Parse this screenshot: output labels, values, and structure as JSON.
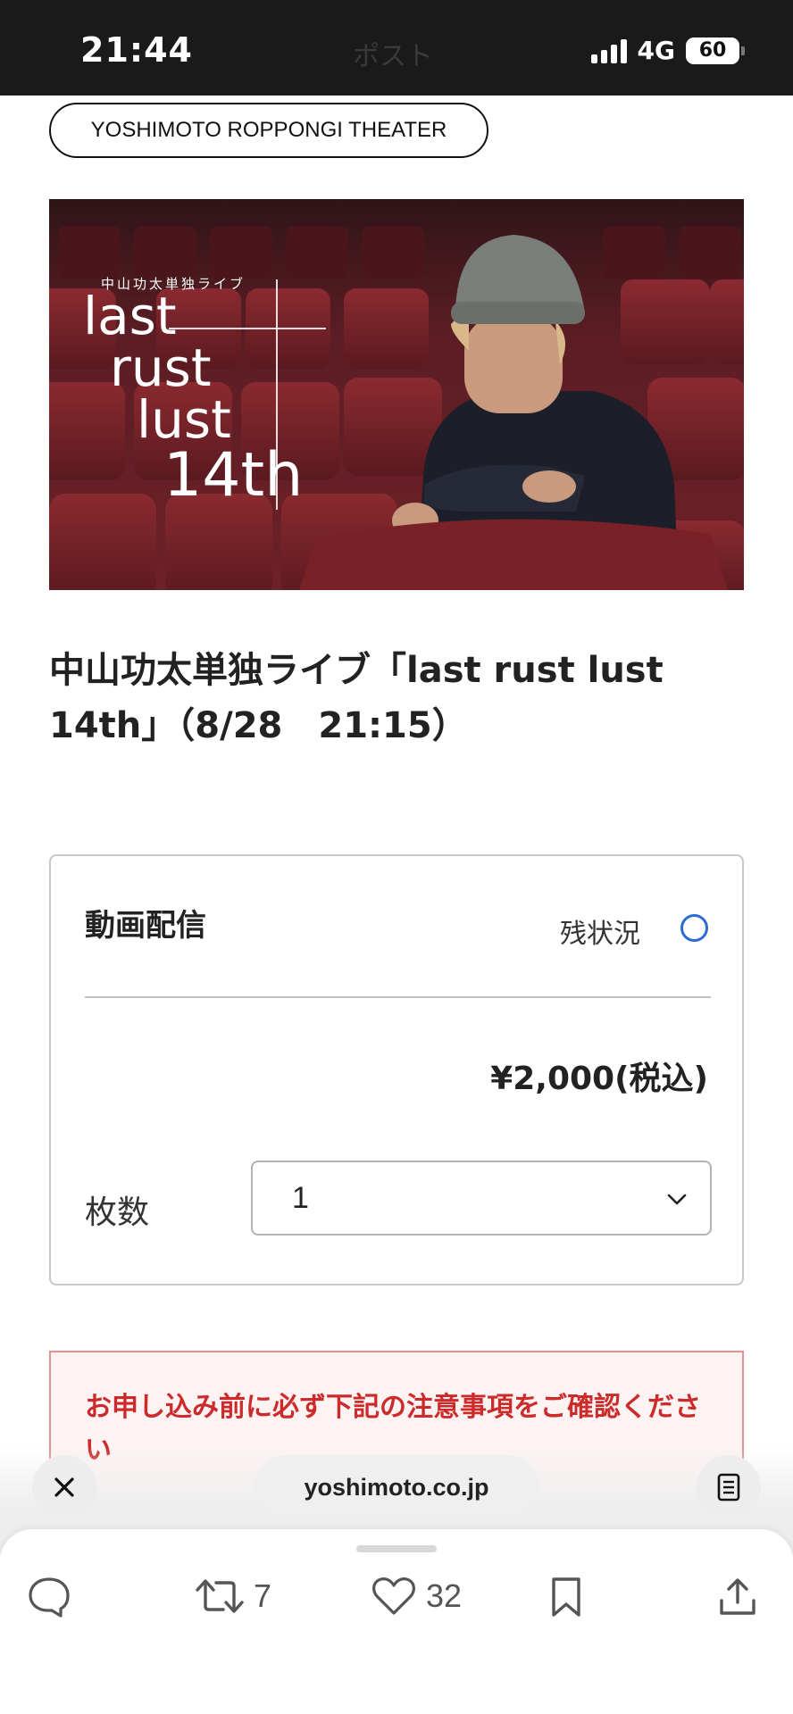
{
  "status_bar": {
    "time": "21:44",
    "ghost_title": "ポスト",
    "network": "4G",
    "battery": "60"
  },
  "theater": {
    "label": "YOSHIMOTO ROPPONGI THEATER"
  },
  "hero": {
    "subtitle": "中山功太単独ライブ",
    "lines": [
      "last",
      "rust",
      "lust",
      "14th"
    ]
  },
  "event": {
    "title": "中山功太単独ライブ「last rust lust 14th」（8/28　21:15）"
  },
  "ticket": {
    "type": "動画配信",
    "availability_label": "残状況",
    "availability_status": "available-circle",
    "price": "¥2,000(税込)",
    "quantity_label": "枚数",
    "quantity_value": "1",
    "colors": {
      "availability": "#2d6bd6"
    }
  },
  "notice": {
    "text": "お申し込み前に必ず下記の注意事項をご確認ください",
    "color": "#cc2b2b"
  },
  "browser": {
    "url": "yoshimoto.co.jp",
    "close_icon": "close-icon",
    "reader_icon": "reader-icon"
  },
  "actions": {
    "reply_icon": "reply-icon",
    "repost_count": "7",
    "like_count": "32",
    "bookmark_icon": "bookmark-icon",
    "share_icon": "share-icon"
  }
}
